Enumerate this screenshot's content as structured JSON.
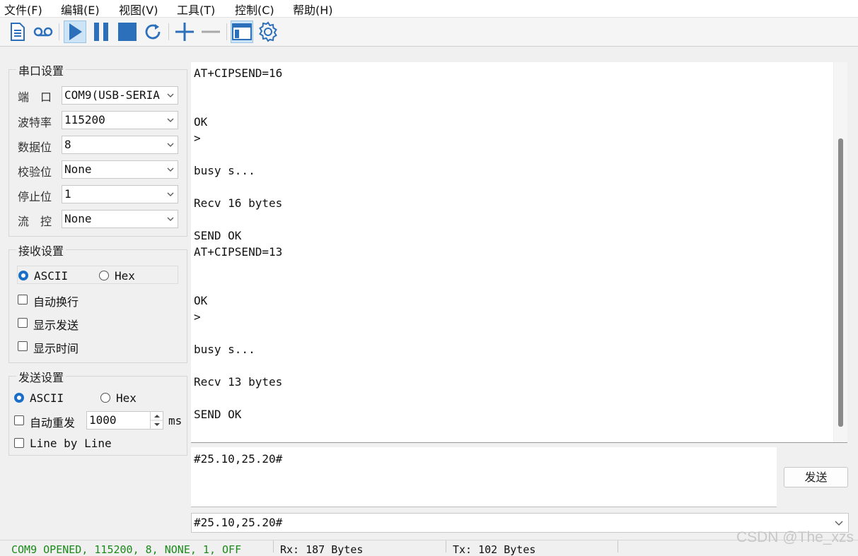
{
  "menu": [
    "文件(F)",
    "编辑(E)",
    "视图(V)",
    "工具(T)",
    "控制(C)",
    "帮助(H)"
  ],
  "toolbar": {
    "icons": [
      "new-file-icon",
      "record-icon",
      "play-icon",
      "pause-icon",
      "stop-icon",
      "refresh-icon",
      "add-icon",
      "remove-icon",
      "window-icon",
      "settings-icon"
    ],
    "accent": "#2c6fba"
  },
  "serial": {
    "title": "串口设置",
    "port_label": "端　口",
    "port_value": "COM9(USB-SERIA",
    "baud_label": "波特率",
    "baud_value": "115200",
    "databits_label": "数据位",
    "databits_value": "8",
    "parity_label": "校验位",
    "parity_value": "None",
    "stopbits_label": "停止位",
    "stopbits_value": "1",
    "flow_label": "流　控",
    "flow_value": "None"
  },
  "receive": {
    "title": "接收设置",
    "ascii": "ASCII",
    "hex": "Hex",
    "wrap": "自动换行",
    "show_send": "显示发送",
    "show_time": "显示时间"
  },
  "send": {
    "title": "发送设置",
    "ascii": "ASCII",
    "hex": "Hex",
    "auto_resend": "自动重发",
    "interval": "1000",
    "unit": "ms",
    "line_by_line": "Line by Line"
  },
  "output_lines": [
    {
      "text": "AT+CIPSEND=16",
      "row": 0
    },
    {
      "text": "OK",
      "row": 3
    },
    {
      "text": ">",
      "row": 4
    },
    {
      "text": "busy s...",
      "row": 6
    },
    {
      "text": "Recv 16 bytes",
      "row": 8
    },
    {
      "text": "SEND OK",
      "row": 10
    },
    {
      "text": "AT+CIPSEND=13",
      "row": 11
    },
    {
      "text": "OK",
      "row": 14
    },
    {
      "text": ">",
      "row": 15
    },
    {
      "text": "busy s...",
      "row": 17
    },
    {
      "text": "Recv 13 bytes",
      "row": 19
    },
    {
      "text": "SEND OK",
      "row": 21
    }
  ],
  "input": {
    "text": "#25.10,25.20#",
    "send_button": "发送",
    "history_value": "#25.10,25.20#"
  },
  "status": {
    "port_status": "COM9 OPENED, 115200, 8, NONE, 1, OFF",
    "rx": "Rx: 187 Bytes",
    "tx": "Tx: 102 Bytes",
    "port_status_color": "#1a8a1a"
  },
  "watermark": "CSDN @The_xzs"
}
